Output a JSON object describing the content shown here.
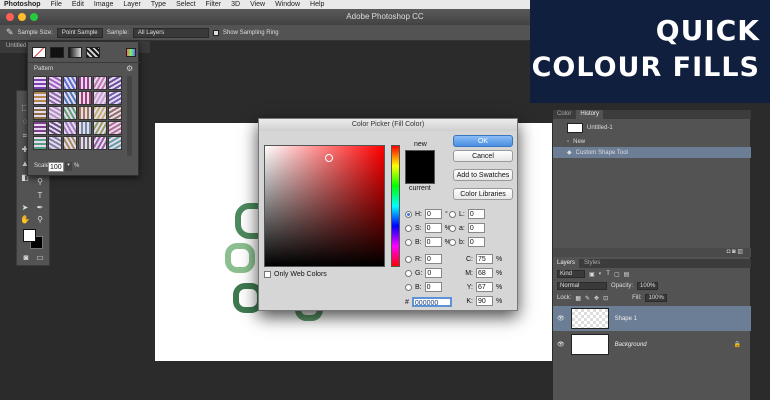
{
  "menubar": {
    "app": "Photoshop",
    "items": [
      "File",
      "Edit",
      "Image",
      "Layer",
      "Type",
      "Select",
      "Filter",
      "3D",
      "View",
      "Window",
      "Help"
    ]
  },
  "window": {
    "title": "Adobe Photoshop CC"
  },
  "options": {
    "sample_size_label": "Sample Size:",
    "sample_size_value": "Point Sample",
    "sample_label": "Sample:",
    "sample_value": "All Layers",
    "ring_label": "Show Sampling Ring"
  },
  "doc_tab": "Untitled-",
  "pattern_panel": {
    "title": "Pattern",
    "scale_label": "Scale:",
    "scale_value": "100",
    "scale_unit": "%"
  },
  "picker": {
    "title": "Color Picker (Fill Color)",
    "new_label": "new",
    "current_label": "current",
    "ok": "OK",
    "cancel": "Cancel",
    "add_swatches": "Add to Swatches",
    "libraries": "Color Libraries",
    "only_web": "Only Web Colors",
    "hex_label": "#",
    "hex_value": "000000",
    "fields": {
      "H": {
        "label": "H:",
        "value": "0",
        "unit": "°"
      },
      "S": {
        "label": "S:",
        "value": "0",
        "unit": "%"
      },
      "B": {
        "label": "B:",
        "value": "0",
        "unit": "%"
      },
      "R": {
        "label": "R:",
        "value": "0"
      },
      "G": {
        "label": "G:",
        "value": "0"
      },
      "Bl": {
        "label": "B:",
        "value": "0"
      },
      "L": {
        "label": "L:",
        "value": "0"
      },
      "a": {
        "label": "a:",
        "value": "0"
      },
      "b": {
        "label": "b:",
        "value": "0"
      },
      "C": {
        "label": "C:",
        "value": "75",
        "unit": "%"
      },
      "M": {
        "label": "M:",
        "value": "68",
        "unit": "%"
      },
      "Y": {
        "label": "Y:",
        "value": "67",
        "unit": "%"
      },
      "K": {
        "label": "K:",
        "value": "90",
        "unit": "%"
      }
    }
  },
  "history_panel": {
    "tabs": [
      "Color",
      "History"
    ],
    "doc_name": "Untitled-1",
    "items": [
      "New",
      "Custom Shape Tool"
    ]
  },
  "layers_panel": {
    "tabs": [
      "Layers",
      "Styles"
    ],
    "kind_label": "Kind",
    "blend_mode": "Normal",
    "opacity_label": "Opacity:",
    "opacity_value": "100%",
    "lock_label": "Lock:",
    "fill_label": "Fill:",
    "fill_value": "100%",
    "layers": [
      {
        "name": "Shape 1"
      },
      {
        "name": "Background"
      }
    ]
  },
  "banner": {
    "line1": "QUICK",
    "line2": "COLOUR FILLS",
    "bg_color": "#0f1f3d"
  }
}
